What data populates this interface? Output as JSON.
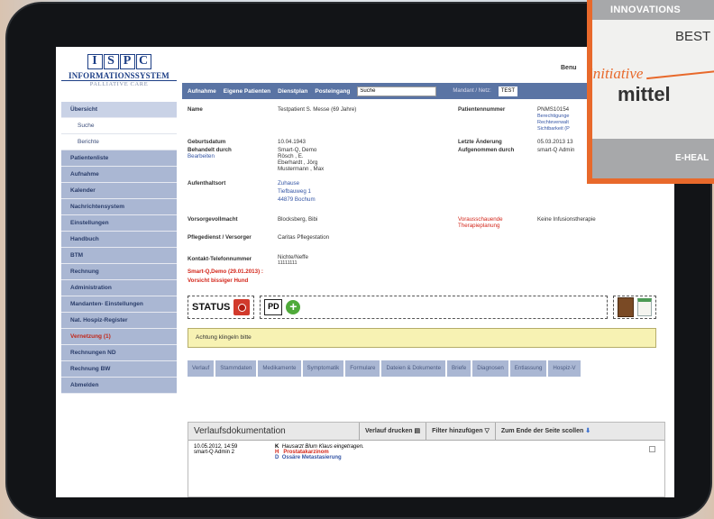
{
  "logo": {
    "letters": [
      "I",
      "S",
      "P",
      "C"
    ],
    "line1": "INFORMATIONSSYSTEM",
    "line2": "PALLIATIVE CARE"
  },
  "user_label": "Benu",
  "topnav": {
    "items": [
      "Aufnahme",
      "Eigene Patienten",
      "Dienstplan",
      "Posteingang"
    ],
    "search_value": "Suche",
    "mandant_label": "Mandant / Netz:",
    "mandant_value": "TEST"
  },
  "sidebar": {
    "items": [
      {
        "label": "Übersicht",
        "type": "main"
      },
      {
        "label": "Suche",
        "type": "sub"
      },
      {
        "label": "Berichte",
        "type": "sub"
      },
      {
        "label": "Patientenliste",
        "type": "main"
      },
      {
        "label": "Aufnahme",
        "type": "main"
      },
      {
        "label": "Kalender",
        "type": "main"
      },
      {
        "label": "Nachrichtensystem",
        "type": "main"
      },
      {
        "label": "Einstellungen",
        "type": "main"
      },
      {
        "label": "Handbuch",
        "type": "main"
      },
      {
        "label": "BTM",
        "type": "main"
      },
      {
        "label": "Rechnung",
        "type": "main"
      },
      {
        "label": "Administration",
        "type": "main"
      },
      {
        "label": "Mandanten- Einstellungen",
        "type": "main"
      },
      {
        "label": "Nat. Hospiz-Register",
        "type": "main"
      },
      {
        "label": "Vernetzung (1)",
        "type": "alert"
      },
      {
        "label": "Rechnungen ND",
        "type": "main"
      },
      {
        "label": "Rechnung BW",
        "type": "main"
      },
      {
        "label": "Abmelden",
        "type": "main"
      }
    ]
  },
  "patient": {
    "name_label": "Name",
    "name_value": "Testpatient S. Messe (69 Jahre)",
    "patnr_label": "Patientennummer",
    "patnr_value": "PNMS10154",
    "patnr_sub1": "Berechtigunge",
    "patnr_sub2": "Rechteverwalt",
    "patnr_sub3": "Sichtbarkeit (P",
    "geburt_label": "Geburtsdatum",
    "geburt_value": "10.04.1943",
    "aenderung_label": "Letzte Änderung",
    "aenderung_value": "05.03.2013 13",
    "behandelt_label": "Behandelt durch",
    "behandelt_edit": "Bearbeiten",
    "behandelt_value1": "Smart-Q, Demo",
    "behandelt_value2": "Rösch , E.",
    "behandelt_value3": "Eberhardt , Jörg",
    "behandelt_value4": "Mustermann , Max",
    "aufgenommen_label": "Aufgenommen durch",
    "aufgenommen_value": "smart-Q Admin",
    "aufenthalt_label": "Aufenthaltsort",
    "aufenthalt_value1": "Zuhause",
    "aufenthalt_value2": "Tiefbauweg 1",
    "aufenthalt_value3": "44879 Bochum",
    "vorsorge_label": "Vorsorgevollmacht",
    "vorsorge_value": "Blocksberg, Bibi",
    "voraus_label1": "Vorausschauende",
    "voraus_label2": "Therapieplanung",
    "voraus_value": "Keine Infusionstherapie",
    "pflege_label": "Pflegedienst / Versorger",
    "pflege_value": "Caritas Pflegestation",
    "kontakt_label": "Kontakt-Telefonnummer",
    "kontakt_value1": "Nichte/Neffe",
    "kontakt_value2": "11111111",
    "warn1": "Smart-Q,Demo (29.01.2013) :",
    "warn2": "Vorsicht bissiger Hund"
  },
  "toolbar": {
    "status_label": "STATUS",
    "pd_label": "PD",
    "plus_label": "+"
  },
  "notice": "Achtung klingeln bitte",
  "tabs": [
    "Verlauf",
    "Stammdaten",
    "Medikamente",
    "Symptomatik",
    "Formulare",
    "Dateien & Dokumente",
    "Briefe",
    "Diagnosen",
    "Entlassung",
    "Hospiz-V"
  ],
  "verlauf": {
    "title": "Verlaufsdokumentation",
    "print_btn": "Verlauf drucken",
    "filter_btn": "Filter hinzufügen",
    "scroll_btn": "Zum Ende der Seite scollen",
    "entry_date": "10.05.2012, 14:59",
    "entry_user": "smart-Q Admin 2",
    "lines": [
      {
        "code": "K",
        "text": "Hausarzt Blum Klaus eingetragen.",
        "color": "#333333"
      },
      {
        "code": "H",
        "text": "Prostatakarzinom",
        "color": "#d3261a"
      },
      {
        "code": "D",
        "text": "Ossäre Metastasierung",
        "color": "#3455a5"
      }
    ]
  },
  "badge": {
    "top": "INNOVATIONS",
    "best": "BEST",
    "initiative": "initiative",
    "mittel": "mittel",
    "bottom": "E-HEAL"
  },
  "colors": {
    "nav": "#5a74a4",
    "sidebar": "#aab7d3",
    "accent_orange": "#e8692b",
    "alert_red": "#d3261a"
  }
}
